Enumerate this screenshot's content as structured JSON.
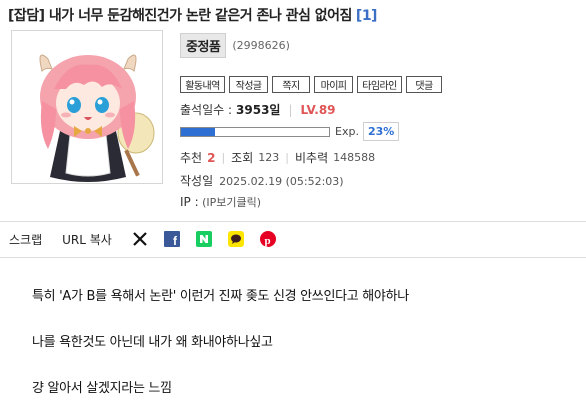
{
  "post": {
    "title": "[잡담] 내가 너무 둔감해진건가 논란 같은거 존나 관심 없어짐",
    "comment_count": "[1]"
  },
  "author": {
    "nickname": "중정품",
    "user_id": "(2998626)",
    "menu": [
      "활동내역",
      "작성글",
      "쪽지",
      "마이피",
      "타임라인",
      "댓글"
    ],
    "attendance_label": "출석일수 :",
    "attendance_value": "3953일",
    "level": "LV.89",
    "exp_label": "Exp.",
    "exp_percent": "23%",
    "exp_fraction": 0.23
  },
  "stats": {
    "recommend_label": "추천",
    "recommend_value": "2",
    "views_label": "조회",
    "views_value": "123",
    "ratio_label": "비추력",
    "ratio_value": "148588"
  },
  "meta": {
    "date_label": "작성일",
    "date_value": "2025.02.19 (05:52:03)",
    "ip_label": "IP :",
    "ip_value": "(IP보기클릭)"
  },
  "share": {
    "scrap_label": "스크랩",
    "url_copy_label": "URL 복사",
    "icons": [
      "x-icon",
      "facebook-icon",
      "naver-icon",
      "kakaotalk-icon",
      "pinterest-icon"
    ]
  },
  "body": {
    "lines": [
      "특히 'A가 B를 욕해서 논란' 이런거 진짜 좆도 신경 안쓰인다고 해야하나",
      "나를 욕한것도 아닌데 내가 왜 화내야하나싶고",
      "걍 알아서 살겠지라는 느낌"
    ]
  },
  "colors": {
    "level": "#e05555",
    "exp_fill": "#2e6fd4",
    "comment_count": "#3b6fc4"
  }
}
